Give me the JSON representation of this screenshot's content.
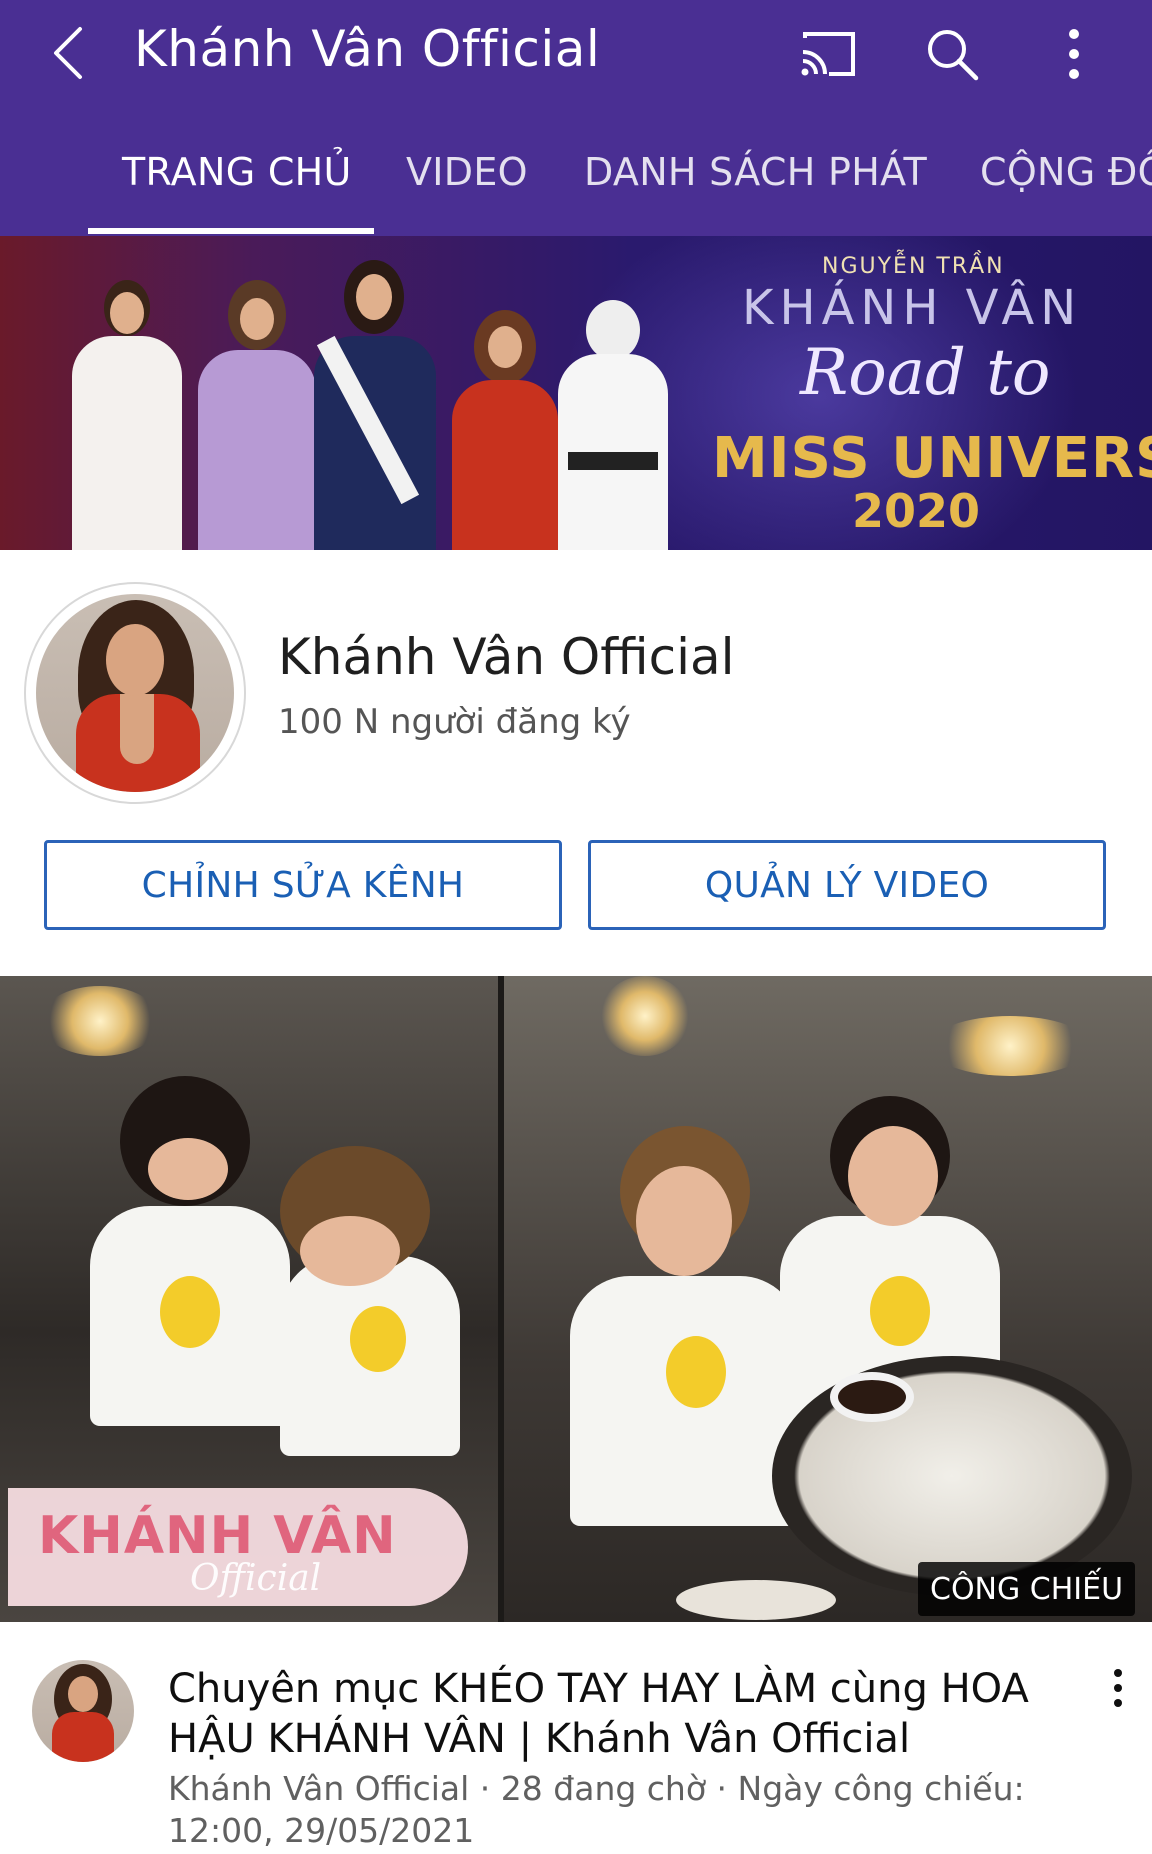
{
  "appbar": {
    "title": "Khánh Vân Official",
    "icons": {
      "back": "chevron-left-icon",
      "cast": "cast-icon",
      "search": "search-icon",
      "more": "more-vertical-icon"
    },
    "tabs": [
      {
        "label": "TRANG CHỦ",
        "active": true
      },
      {
        "label": "VIDEO",
        "active": false
      },
      {
        "label": "DANH SÁCH PHÁT",
        "active": false
      },
      {
        "label": "CỘNG ĐỒ",
        "active": false
      }
    ]
  },
  "banner": {
    "pretitle": "NGUYỄN TRẦN",
    "name": "KHÁNH VÂN",
    "road": "Road to",
    "miss": "MISS UNIVERSE",
    "year": "2020"
  },
  "channel": {
    "name": "Khánh Vân Official",
    "subscribers": "100 N người đăng ký",
    "edit_button": "CHỈNH SỬA KÊNH",
    "manage_button": "QUẢN LÝ VIDEO"
  },
  "featured_video": {
    "logo_main": "KHÁNH VÂN",
    "logo_sub": "Official",
    "badge": "CÔNG CHIẾU",
    "title": "Chuyên mục KHÉO TAY HAY LÀM cùng HOA HẬU KHÁNH VÂN | Khánh Vân Official",
    "subtitle": "Khánh Vân Official · 28 đang chờ · Ngày công chiếu: 12:00, 29/05/2021"
  },
  "colors": {
    "appbar": "#4a2f93",
    "button_text": "#1a5fb4",
    "button_border": "#2b63b8"
  }
}
